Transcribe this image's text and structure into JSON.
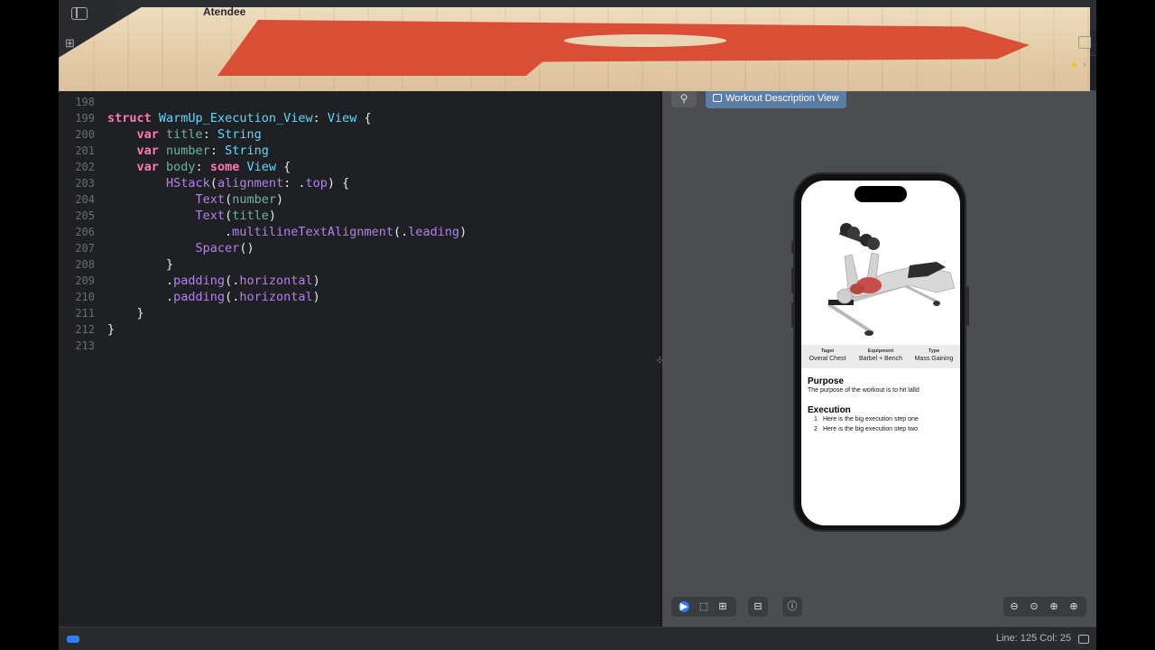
{
  "window": {
    "title": "Atendee"
  },
  "editor": {
    "lines": [
      {
        "n": "198",
        "tokens": []
      },
      {
        "n": "199",
        "tokens": [
          [
            "kw",
            "struct"
          ],
          [
            "pl",
            " "
          ],
          [
            "ty",
            "WarmUp_Execution_View"
          ],
          [
            "pl",
            ": "
          ],
          [
            "ty",
            "View"
          ],
          [
            "pl",
            " {"
          ]
        ]
      },
      {
        "n": "200",
        "tokens": [
          [
            "pl",
            "    "
          ],
          [
            "kw",
            "var"
          ],
          [
            "pl",
            " "
          ],
          [
            "prop",
            "title"
          ],
          [
            "pl",
            ": "
          ],
          [
            "ty",
            "String"
          ]
        ]
      },
      {
        "n": "201",
        "tokens": [
          [
            "pl",
            "    "
          ],
          [
            "kw",
            "var"
          ],
          [
            "pl",
            " "
          ],
          [
            "prop",
            "number"
          ],
          [
            "pl",
            ": "
          ],
          [
            "ty",
            "String"
          ]
        ]
      },
      {
        "n": "202",
        "tokens": [
          [
            "pl",
            "    "
          ],
          [
            "kw",
            "var"
          ],
          [
            "pl",
            " "
          ],
          [
            "prop",
            "body"
          ],
          [
            "pl",
            ": "
          ],
          [
            "kw",
            "some"
          ],
          [
            "pl",
            " "
          ],
          [
            "ty",
            "View"
          ],
          [
            "pl",
            " {"
          ]
        ]
      },
      {
        "n": "203",
        "tokens": [
          [
            "pl",
            "        "
          ],
          [
            "fn",
            "HStack"
          ],
          [
            "pl",
            "("
          ],
          [
            "fn",
            "alignment"
          ],
          [
            "pl",
            ": ."
          ],
          [
            "fn",
            "top"
          ],
          [
            "pl",
            ") {"
          ]
        ]
      },
      {
        "n": "204",
        "tokens": [
          [
            "pl",
            "            "
          ],
          [
            "fn",
            "Text"
          ],
          [
            "pl",
            "("
          ],
          [
            "prop",
            "number"
          ],
          [
            "pl",
            ")"
          ]
        ]
      },
      {
        "n": "205",
        "tokens": [
          [
            "pl",
            "            "
          ],
          [
            "fn",
            "Text"
          ],
          [
            "pl",
            "("
          ],
          [
            "prop",
            "title"
          ],
          [
            "pl",
            ")"
          ]
        ]
      },
      {
        "n": "206",
        "tokens": [
          [
            "pl",
            "                ."
          ],
          [
            "fn",
            "multilineTextAlignment"
          ],
          [
            "pl",
            "(."
          ],
          [
            "fn",
            "leading"
          ],
          [
            "pl",
            ")"
          ]
        ]
      },
      {
        "n": "207",
        "tokens": [
          [
            "pl",
            "            "
          ],
          [
            "fn",
            "Spacer"
          ],
          [
            "pl",
            "()"
          ]
        ]
      },
      {
        "n": "208",
        "tokens": [
          [
            "pl",
            "        }"
          ]
        ]
      },
      {
        "n": "209",
        "tokens": [
          [
            "pl",
            "        ."
          ],
          [
            "fn",
            "padding"
          ],
          [
            "pl",
            "(."
          ],
          [
            "fn",
            "horizontal"
          ],
          [
            "pl",
            ")"
          ]
        ]
      },
      {
        "n": "210",
        "tokens": [
          [
            "pl",
            "        ."
          ],
          [
            "fn",
            "padding"
          ],
          [
            "pl",
            "(."
          ],
          [
            "fn",
            "horizontal"
          ],
          [
            "pl",
            ")"
          ]
        ]
      },
      {
        "n": "211",
        "tokens": [
          [
            "pl",
            "    }"
          ]
        ]
      },
      {
        "n": "212",
        "tokens": [
          [
            "pl",
            "}"
          ]
        ]
      },
      {
        "n": "213",
        "tokens": []
      }
    ]
  },
  "preview": {
    "pin_icon": "pin-icon",
    "tab_label": "Workout Description View",
    "phone": {
      "stats": [
        {
          "label": "Taget",
          "value": "Overal Chest"
        },
        {
          "label": "Equipment",
          "value": "Barbel + Bench"
        },
        {
          "label": "Type",
          "value": "Mass Gaining"
        }
      ],
      "purpose_title": "Purpose",
      "purpose_text": "The purpose of the workout is to hit lalld",
      "execution_title": "Execution",
      "steps": [
        {
          "num": "1",
          "text": "Here is the big execution step one"
        },
        {
          "num": "2",
          "text": "Here is the big execution step two"
        }
      ]
    }
  },
  "statusbar": {
    "position": "Line: 125  Col: 25"
  },
  "colors": {
    "keyword": "#ff7ab2",
    "type": "#5dd8ff",
    "property": "#67b7a4",
    "function": "#b281eb",
    "accent": "#2f7ff6"
  }
}
